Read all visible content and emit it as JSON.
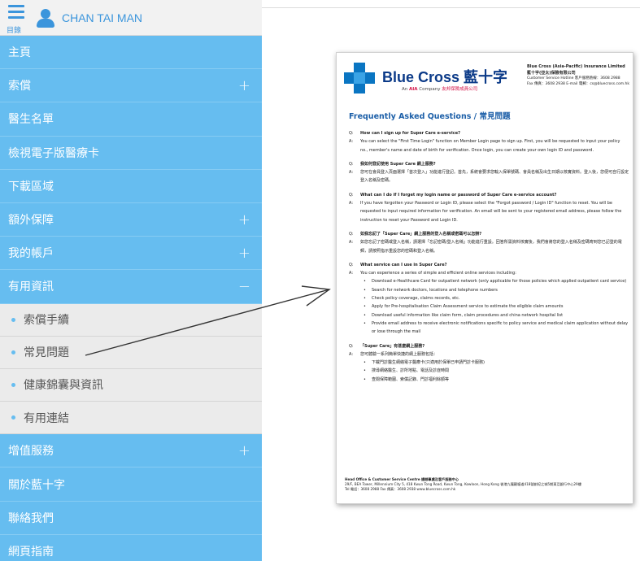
{
  "header": {
    "menu_label": "目錄",
    "user_name": "CHAN TAI MAN"
  },
  "sidebar": {
    "items": [
      {
        "label": "主頁",
        "expander": ""
      },
      {
        "label": "索償",
        "expander": "+"
      },
      {
        "label": "醫生名單",
        "expander": ""
      },
      {
        "label": "檢視電子版醫療卡",
        "expander": ""
      },
      {
        "label": "下載區域",
        "expander": ""
      },
      {
        "label": "額外保障",
        "expander": "+"
      },
      {
        "label": "我的帳戶",
        "expander": "+"
      },
      {
        "label": "有用資訊",
        "expander": "−"
      }
    ],
    "sub_items": [
      {
        "label": "索償手續"
      },
      {
        "label": "常見問題"
      },
      {
        "label": "健康錦囊與資訊"
      },
      {
        "label": "有用連結"
      }
    ],
    "items_after": [
      {
        "label": "增值服務",
        "expander": "+"
      },
      {
        "label": "關於藍十字",
        "expander": ""
      },
      {
        "label": "聯絡我們",
        "expander": ""
      },
      {
        "label": "網頁指南",
        "expander": ""
      }
    ]
  },
  "document": {
    "brand_name": "Blue Cross 藍十字",
    "brand_sub_prefix": "An ",
    "brand_sub_aia": "AIA",
    "brand_sub_mid": " Company ",
    "brand_sub_cn": "友邦保險成員公司",
    "company_name_en": "Blue Cross (Asia-Pacific) Insurance Limited",
    "company_name_cn": "藍十字(亞太)保險有限公司",
    "company_hotline": "Customer Service Hotline 客戶服務熱線：3608 2988",
    "company_fax": "Fax 傳真：3608 2938   E-mail 電郵：cs@bluecross.com.hk",
    "title": "Frequently Asked Questions / 常見問題",
    "qas": [
      {
        "q": "How can I sign up for Super Care e-service?",
        "a": "You can select the \"First Time Login\" function on Member Login page to sign up. First, you will be requested to input your policy no., member's name and date of birth for verification. Once login, you can create your own login ID and password.",
        "bullets": []
      },
      {
        "q": "我如何登記使用 Super Care 網上服務?",
        "a": "您可在會員登入頁面選擇「首次登入」功能進行登記。首先，系統會要求您輸入保單號碼、會員名稱及出生日期以核實資料。登入後，您便可自行設定登入名稱及密碼。",
        "bullets": []
      },
      {
        "q": "What can I do if I forget my login name or password of Super Care e-service account?",
        "a": "If you have forgotten your Password or Login ID, please select the \"Forgot password / Login ID\" function to reset. You will be requested to input required information for verification. An email will be sent to your registered email address, please follow the instruction to reset your Password and Login ID.",
        "bullets": []
      },
      {
        "q": "如我忘記了「Super Care」網上服務的登入名稱或密碼可以怎辦?",
        "a": "如您忘記了密碼或登入名稱，請選擇「忘記密碼/登入名稱」功能進行重設。回答所需資料核實後，我們會將您的登入名稱及密碼寄到您已記登的電郵，請按照指示重設您的密碼和登入名稱。",
        "bullets": []
      },
      {
        "q": "What service can I use in Super Care?",
        "a": "You can experience a series of simple and efficient online services including:",
        "bullets": [
          "Download e-Healthcare Card for outpatient network (only applicable for those policies which applied outpatient card service)",
          "Search for network doctors, locations and telephone numbers",
          "Check policy coverage, claims records, etc.",
          "Apply for Pre-hospitalisation Claim Assessment service to estimate the eligible claim amounts",
          "Download useful information like claim form, claim procedures and china network hospital list",
          "Provide email address to receive electronic notifications specific to policy service and medical claim application without delay or lose through the mail"
        ]
      },
      {
        "q": "「Super Care」有甚麼網上服務?",
        "a": "您可體驗一系列簡單快捷的網上服務包括：",
        "bullets": [
          "下載門診醫生網絡電子醫療卡(只適用於保單已申請門診卡服務)",
          "搜尋網絡醫生、診所地點、電話及診症時間",
          "查閱保障範圍、索償記錄、門診福利餘額等"
        ]
      }
    ],
    "footer_line1": "Head Office & Customer Service Centre 總辦事處及客戶服務中心",
    "footer_line2": "29/F, BEA Tower, Millennium City 5, 418 Kwun Tong Road, Kwun Tong, Kowloon, Hong Kong 香港九龍觀塘道418號創紀之城5期東亞銀行中心29樓",
    "footer_line3": "Tel 電話：3608 2988   Fax 傳真：3608 2938   www.bluecross.com.hk"
  },
  "colors": {
    "sidebar_bg": "#66bdf0",
    "sub_bg": "#ebebeb",
    "accent": "#3b95dc",
    "title_blue": "#1c5fa8"
  }
}
